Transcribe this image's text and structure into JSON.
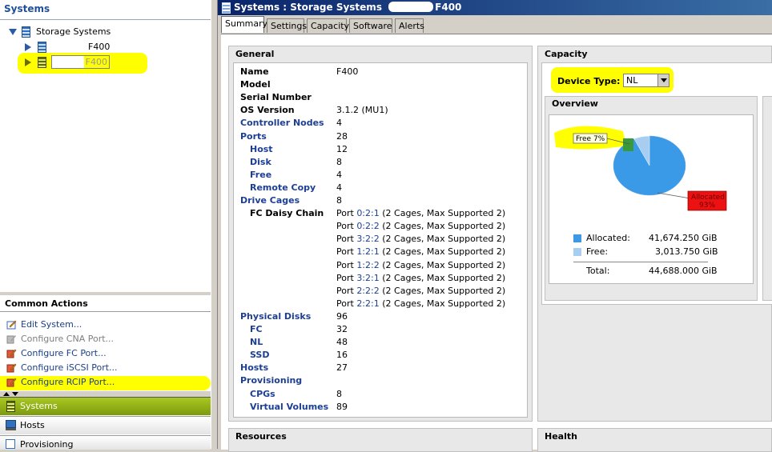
{
  "left": {
    "header": "Systems",
    "tree": {
      "root": "Storage Systems",
      "items": [
        "F400",
        "F400"
      ]
    },
    "common_actions": {
      "title": "Common Actions",
      "items": [
        {
          "label": "Edit System...",
          "enabled": true
        },
        {
          "label": "Configure CNA Port...",
          "enabled": false
        },
        {
          "label": "Configure FC Port...",
          "enabled": true
        },
        {
          "label": "Configure iSCSI Port...",
          "enabled": true
        },
        {
          "label": "Configure RCIP Port...",
          "enabled": true
        }
      ]
    },
    "nav": [
      {
        "label": "Systems",
        "selected": true
      },
      {
        "label": "Hosts",
        "selected": false
      },
      {
        "label": "Provisioning",
        "selected": false
      }
    ]
  },
  "window": {
    "title_prefix": "Systems : Storage Systems",
    "title_suffix": "F400"
  },
  "tabs": [
    "Summary",
    "Settings",
    "Capacity",
    "Software",
    "Alerts"
  ],
  "active_tab": "Summary",
  "general": {
    "title": "General",
    "rows": [
      {
        "label": "Name",
        "value": "F400",
        "link": false,
        "indent": false
      },
      {
        "label": "Model",
        "value": "",
        "link": false,
        "indent": false
      },
      {
        "label": "Serial Number",
        "value": "",
        "link": false,
        "indent": false
      },
      {
        "label": "OS Version",
        "value": "3.1.2 (MU1)",
        "link": false,
        "indent": false
      },
      {
        "label": "Controller Nodes",
        "value": "4",
        "link": true,
        "indent": false
      },
      {
        "label": "Ports",
        "value": "28",
        "link": true,
        "indent": false
      },
      {
        "label": "Host",
        "value": "12",
        "link": true,
        "indent": true
      },
      {
        "label": "Disk",
        "value": "8",
        "link": true,
        "indent": true
      },
      {
        "label": "Free",
        "value": "4",
        "link": true,
        "indent": true
      },
      {
        "label": "Remote Copy",
        "value": "4",
        "link": true,
        "indent": true
      },
      {
        "label": "Drive Cages",
        "value": "8",
        "link": true,
        "indent": false
      },
      {
        "label": "FC Daisy Chain",
        "value": "",
        "link": false,
        "indent": true
      }
    ],
    "daisy_chain": [
      {
        "prefix": "Port",
        "port": "0:2:1",
        "desc": "(2 Cages, Max Supported 2)"
      },
      {
        "prefix": "Port",
        "port": "0:2:2",
        "desc": "(2 Cages, Max Supported 2)"
      },
      {
        "prefix": "Port",
        "port": "3:2:2",
        "desc": "(2 Cages, Max Supported 2)"
      },
      {
        "prefix": "Port",
        "port": "1:2:1",
        "desc": "(2 Cages, Max Supported 2)"
      },
      {
        "prefix": "Port",
        "port": "1:2:2",
        "desc": "(2 Cages, Max Supported 2)"
      },
      {
        "prefix": "Port",
        "port": "3:2:1",
        "desc": "(2 Cages, Max Supported 2)"
      },
      {
        "prefix": "Port",
        "port": "2:2:2",
        "desc": "(2 Cages, Max Supported 2)"
      },
      {
        "prefix": "Port",
        "port": "2:2:1",
        "desc": "(2 Cages, Max Supported 2)"
      }
    ],
    "rows2": [
      {
        "label": "Physical Disks",
        "value": "96",
        "link": true,
        "indent": false
      },
      {
        "label": "FC",
        "value": "32",
        "link": true,
        "indent": true
      },
      {
        "label": "NL",
        "value": "48",
        "link": true,
        "indent": true
      },
      {
        "label": "SSD",
        "value": "16",
        "link": true,
        "indent": true
      },
      {
        "label": "Hosts",
        "value": "27",
        "link": true,
        "indent": false
      },
      {
        "label": "Provisioning",
        "value": "",
        "link": true,
        "indent": false
      },
      {
        "label": "CPGs",
        "value": "8",
        "link": true,
        "indent": true
      },
      {
        "label": "Virtual Volumes",
        "value": "89",
        "link": true,
        "indent": true
      }
    ]
  },
  "capacity": {
    "title": "Capacity",
    "device_type_label": "Device Type:",
    "device_type_value": "NL",
    "overview_title": "Overview",
    "pie": {
      "free_label": "Free 7%",
      "allocated_label": "Allocated",
      "allocated_pct": "93%",
      "allocated_fraction": 0.93,
      "free_fraction": 0.07,
      "colors": {
        "allocated": "#3b9ae8",
        "free": "#a7cdf0",
        "free_badge": "#3a9a3a",
        "allocated_badge": "#ee1111"
      }
    },
    "legend": [
      {
        "name": "Allocated:",
        "value": "41,674.250 GiB",
        "color": "#3b9ae8"
      },
      {
        "name": "Free:",
        "value": "3,013.750 GiB",
        "color": "#a7cdf0"
      }
    ],
    "total": {
      "name": "Total:",
      "value": "44,688.000 GiB"
    }
  },
  "resources_title": "Resources",
  "health_title": "Health"
}
